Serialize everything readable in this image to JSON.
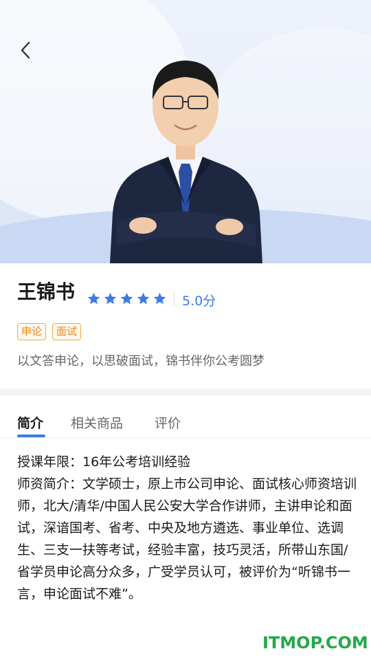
{
  "hero": {
    "back_icon": "chevron-left-icon",
    "photo": "teacher-photo"
  },
  "teacher": {
    "name": "王锦书",
    "rating_stars": 5,
    "score": "5.0分",
    "tags": [
      "申论",
      "面试"
    ],
    "slogan": "以文答申论，以思破面试，锦书伴你公考圆梦"
  },
  "colors": {
    "accent": "#3a7be8",
    "tag": "#e8891d",
    "watermark": "#25a84a"
  },
  "tabs": [
    {
      "label": "简介",
      "active": true
    },
    {
      "label": "相关商品",
      "active": false
    },
    {
      "label": "评价",
      "active": false
    }
  ],
  "intro": {
    "line1": "授课年限：16年公考培训经验",
    "line2": "师资简介：文学硕士，原上市公司申论、面试核心师资培训师，北大/清华/中国人民公安大学合作讲师，主讲申论和面试，深谙国考、省考、中央及地方遴选、事业单位、选调生、三支一扶等考试，经验丰富，技巧灵活，所带山东国/省学员申论高分众多，广受学员认可，被评价为“听锦书一言，申论面试不难”。"
  },
  "watermark": "ITMOP.COM"
}
